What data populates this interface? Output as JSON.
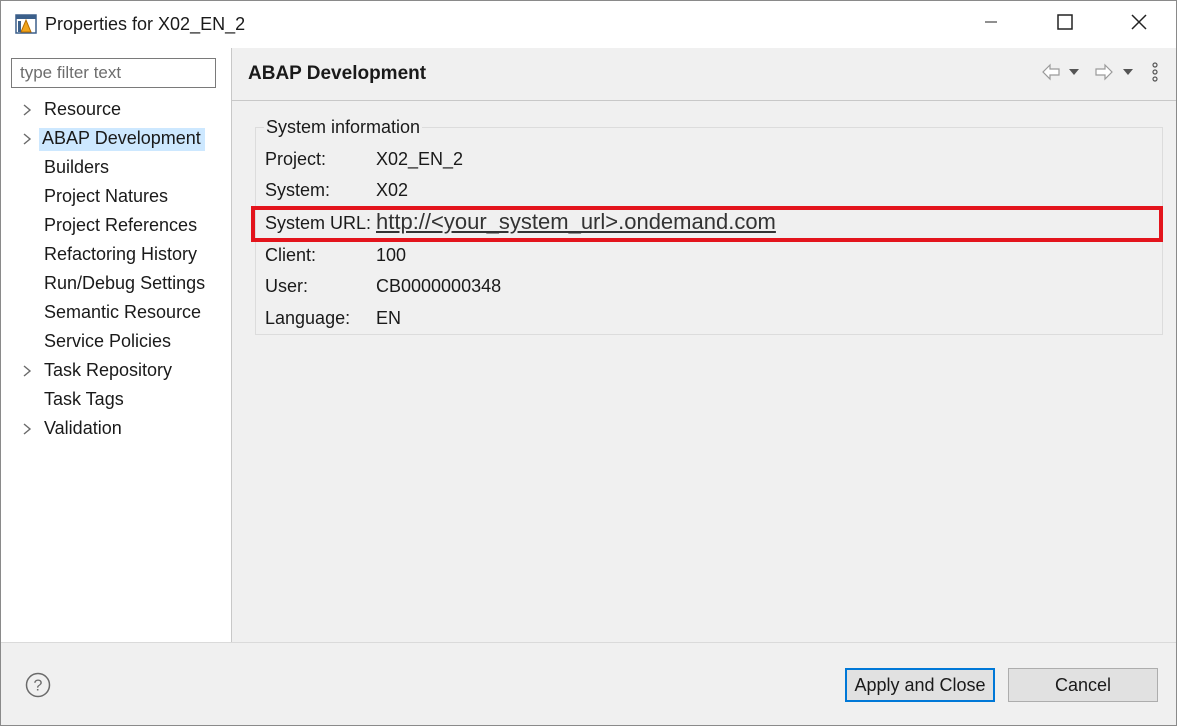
{
  "window": {
    "title": "Properties for X02_EN_2",
    "app_icon": "eclipse-properties-icon",
    "controls": [
      "minimize-icon",
      "maximize-icon",
      "close-icon"
    ]
  },
  "sidebar": {
    "filter_placeholder": "type filter text",
    "filter_value": "",
    "items": [
      {
        "label": "Resource",
        "expandable": true,
        "selected": false
      },
      {
        "label": "ABAP Development",
        "expandable": true,
        "selected": true
      },
      {
        "label": "Builders",
        "expandable": false,
        "selected": false
      },
      {
        "label": "Project Natures",
        "expandable": false,
        "selected": false
      },
      {
        "label": "Project References",
        "expandable": false,
        "selected": false
      },
      {
        "label": "Refactoring History",
        "expandable": false,
        "selected": false
      },
      {
        "label": "Run/Debug Settings",
        "expandable": false,
        "selected": false
      },
      {
        "label": "Semantic Resource",
        "expandable": false,
        "selected": false
      },
      {
        "label": "Service Policies",
        "expandable": false,
        "selected": false
      },
      {
        "label": "Task Repository",
        "expandable": true,
        "selected": false
      },
      {
        "label": "Task Tags",
        "expandable": false,
        "selected": false
      },
      {
        "label": "Validation",
        "expandable": true,
        "selected": false
      }
    ]
  },
  "main": {
    "title": "ABAP Development",
    "group_label": "System information",
    "fields": [
      {
        "key": "Project:",
        "value": "X02_EN_2"
      },
      {
        "key": "System:",
        "value": "X02"
      },
      {
        "key": "System URL:",
        "value": "http://<your_system_url>.ondemand.com"
      },
      {
        "key": "Client:",
        "value": "100"
      },
      {
        "key": "User:",
        "value": "CB0000000348"
      },
      {
        "key": "Language:",
        "value": "EN"
      }
    ],
    "highlight_color": "#e3141c"
  },
  "footer": {
    "apply_close_label": "Apply and Close",
    "cancel_label": "Cancel"
  },
  "colors": {
    "selection": "#cde8ff",
    "primary_button_border": "#0078d7"
  }
}
